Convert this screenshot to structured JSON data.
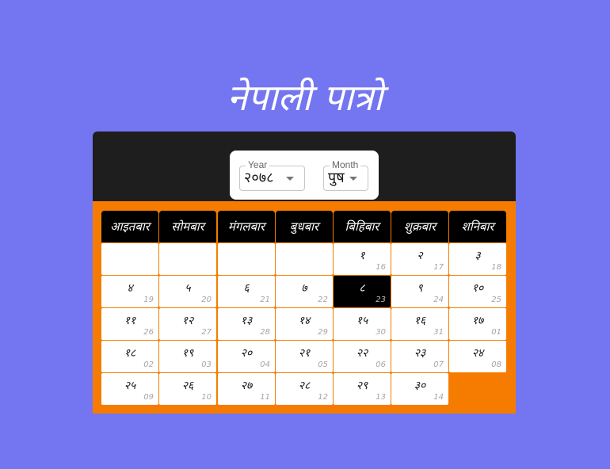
{
  "page": {
    "title": "नेपाली पात्रो"
  },
  "controls": {
    "year": {
      "label": "Year",
      "value": "२०७८"
    },
    "month": {
      "label": "Month",
      "value": "पुष"
    }
  },
  "weekdays": [
    "आइतबार",
    "सोमबार",
    "मंगलबार",
    "बुधबार",
    "बिहिबार",
    "शुक्रबार",
    "शनिबार"
  ],
  "days": [
    {
      "np": "१",
      "en": "16"
    },
    {
      "np": "२",
      "en": "17"
    },
    {
      "np": "३",
      "en": "18"
    },
    {
      "np": "४",
      "en": "19"
    },
    {
      "np": "५",
      "en": "20"
    },
    {
      "np": "६",
      "en": "21"
    },
    {
      "np": "७",
      "en": "22"
    },
    {
      "np": "८",
      "en": "23"
    },
    {
      "np": "९",
      "en": "24"
    },
    {
      "np": "१०",
      "en": "25"
    },
    {
      "np": "११",
      "en": "26"
    },
    {
      "np": "१२",
      "en": "27"
    },
    {
      "np": "१३",
      "en": "28"
    },
    {
      "np": "१४",
      "en": "29"
    },
    {
      "np": "१५",
      "en": "30"
    },
    {
      "np": "१६",
      "en": "31"
    },
    {
      "np": "१७",
      "en": "01"
    },
    {
      "np": "१८",
      "en": "02"
    },
    {
      "np": "१९",
      "en": "03"
    },
    {
      "np": "२०",
      "en": "04"
    },
    {
      "np": "२१",
      "en": "05"
    },
    {
      "np": "२२",
      "en": "06"
    },
    {
      "np": "२३",
      "en": "07"
    },
    {
      "np": "२४",
      "en": "08"
    },
    {
      "np": "२५",
      "en": "09"
    },
    {
      "np": "२६",
      "en": "10"
    },
    {
      "np": "२७",
      "en": "11"
    },
    {
      "np": "२८",
      "en": "12"
    },
    {
      "np": "२९",
      "en": "13"
    },
    {
      "np": "३०",
      "en": "14"
    }
  ],
  "highlighted_day": "८",
  "colors": {
    "background": "#7476f1",
    "accent": "#f57c00",
    "header": "#1e1e1e",
    "today": "#000000"
  }
}
